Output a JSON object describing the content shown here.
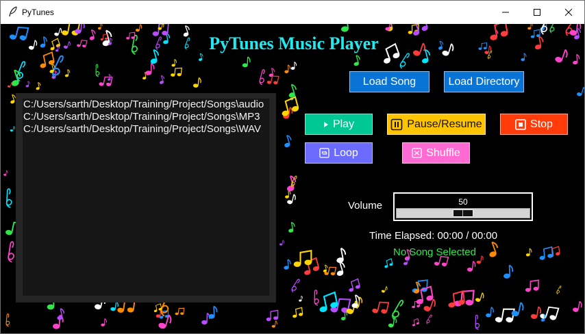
{
  "window": {
    "title": "PyTunes",
    "minimize_icon": "minimize-icon",
    "maximize_icon": "maximize-icon",
    "close_icon": "close-icon"
  },
  "header": {
    "title": "PyTunes Music Player"
  },
  "load": {
    "song_label": "Load Song",
    "directory_label": "Load Directory"
  },
  "controls": {
    "play": {
      "label": "Play",
      "icon": "play-icon",
      "color": "#00c895"
    },
    "pause": {
      "label": "Pause/Resume",
      "icon": "pause-icon",
      "color": "#ffc400"
    },
    "stop": {
      "label": "Stop",
      "icon": "stop-icon",
      "color": "#ff3c0a"
    },
    "loop": {
      "label": "Loop",
      "icon": "loop-icon",
      "color": "#6b6cff"
    },
    "shuffle": {
      "label": "Shuffle",
      "icon": "shuffle-icon",
      "color": "#ff6ad3"
    }
  },
  "playlist": {
    "items": [
      "C:/Users/sarth/Desktop/Training/Project/Songs\\audio",
      "C:/Users/sarth/Desktop/Training/Project/Songs\\MP3",
      "C:/Users/sarth/Desktop/Training/Project/Songs\\WAV"
    ]
  },
  "volume": {
    "label": "Volume",
    "value": "50",
    "level": 0.5
  },
  "status": {
    "time_elapsed": "Time Elapsed: 00:00 / 00:00",
    "message": "No Song Selected"
  },
  "theme": {
    "background": "#000000",
    "title_color": "#22e8ef",
    "load_button_color": "#0a74d6",
    "status_color": "#2ee84a"
  }
}
